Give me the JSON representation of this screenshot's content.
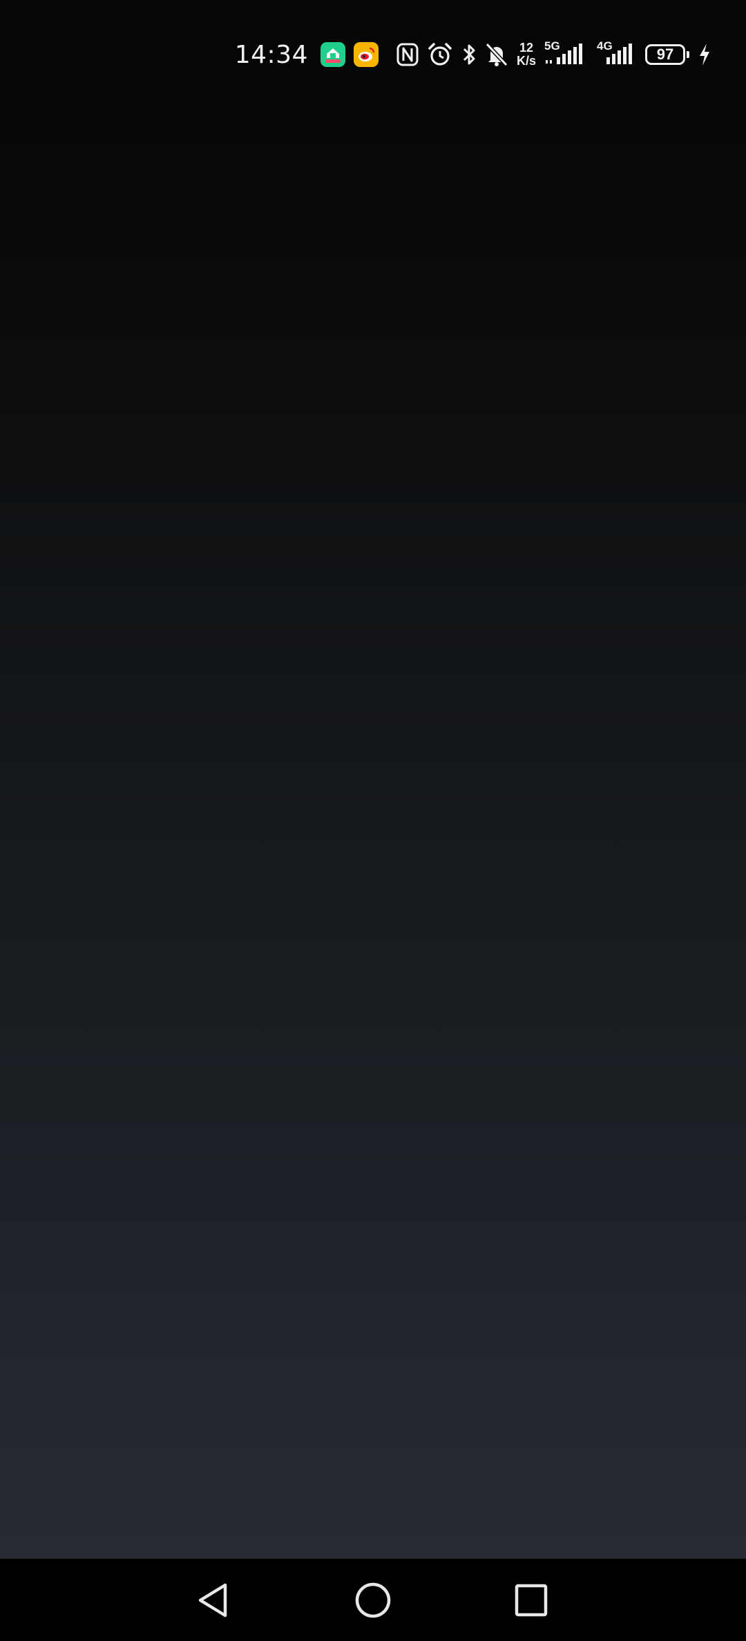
{
  "status_bar": {
    "time": "14:34",
    "app_icons": [
      "app-store-icon",
      "weibo-icon"
    ],
    "system_icons": [
      "nfc-icon",
      "alarm-icon",
      "bluetooth-icon",
      "mute-bell-icon"
    ],
    "network_speed": {
      "value": "12",
      "unit": "K/s"
    },
    "signal_1": {
      "label": "5G"
    },
    "signal_2": {
      "label": "4G"
    },
    "battery_level": "97",
    "charging": true
  },
  "content": {
    "background_top": "#050607",
    "background_bottom": "#262a33"
  },
  "nav_bar": {
    "buttons": [
      "back-icon",
      "home-icon",
      "recents-icon"
    ]
  }
}
